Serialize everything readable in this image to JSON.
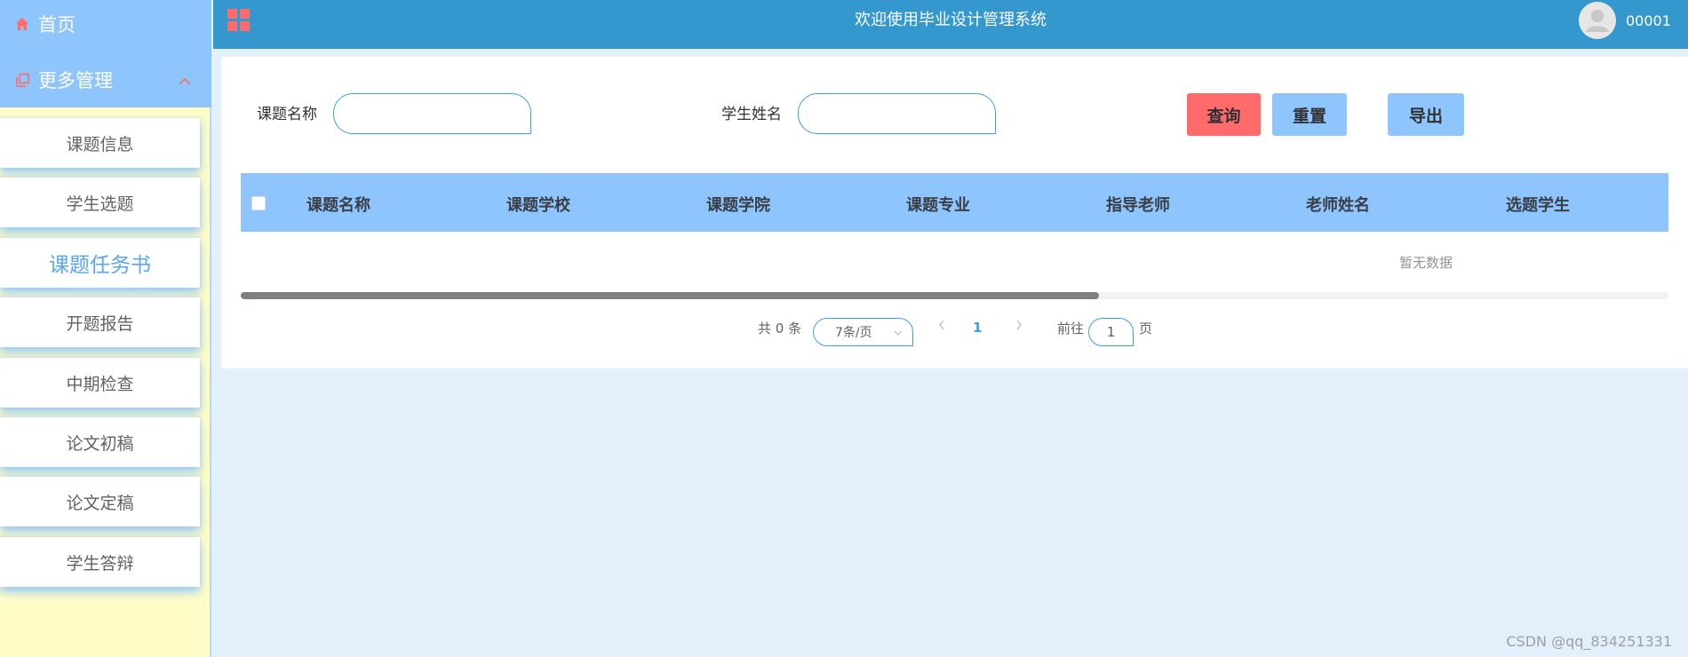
{
  "sidebar": {
    "home_label": "首页",
    "more_label": "更多管理",
    "items": [
      {
        "label": "课题信息"
      },
      {
        "label": "学生选题"
      },
      {
        "label": "课题任务书"
      },
      {
        "label": "开题报告"
      },
      {
        "label": "中期检查"
      },
      {
        "label": "论文初稿"
      },
      {
        "label": "论文定稿"
      },
      {
        "label": "学生答辩"
      }
    ],
    "active_index": 2
  },
  "header": {
    "title": "欢迎使用毕业设计管理系统",
    "username": "00001"
  },
  "search": {
    "topic_label": "课题名称",
    "topic_value": "",
    "student_label": "学生姓名",
    "student_value": "",
    "search_button": "查询",
    "reset_button": "重置",
    "export_button": "导出"
  },
  "table": {
    "columns": [
      "课题名称",
      "课题学校",
      "课题学院",
      "课题专业",
      "指导老师",
      "老师姓名",
      "选题学生"
    ],
    "rows": [],
    "empty_text": "暂无数据"
  },
  "pagination": {
    "total_text": "共 0 条",
    "page_size": "7条/页",
    "current_page": "1",
    "goto_label": "前往",
    "goto_value": "1",
    "page_suffix": "页"
  },
  "watermark": "CSDN @qq_834251331",
  "colors": {
    "sidebar_head": "#8ec5fd",
    "sidebar_bg": "#fffdc5",
    "header_bg": "#3498cf",
    "search_button": "#ff6b6b",
    "secondary_button": "#8ec5fd",
    "icon_accent": "#ff6b6b"
  }
}
